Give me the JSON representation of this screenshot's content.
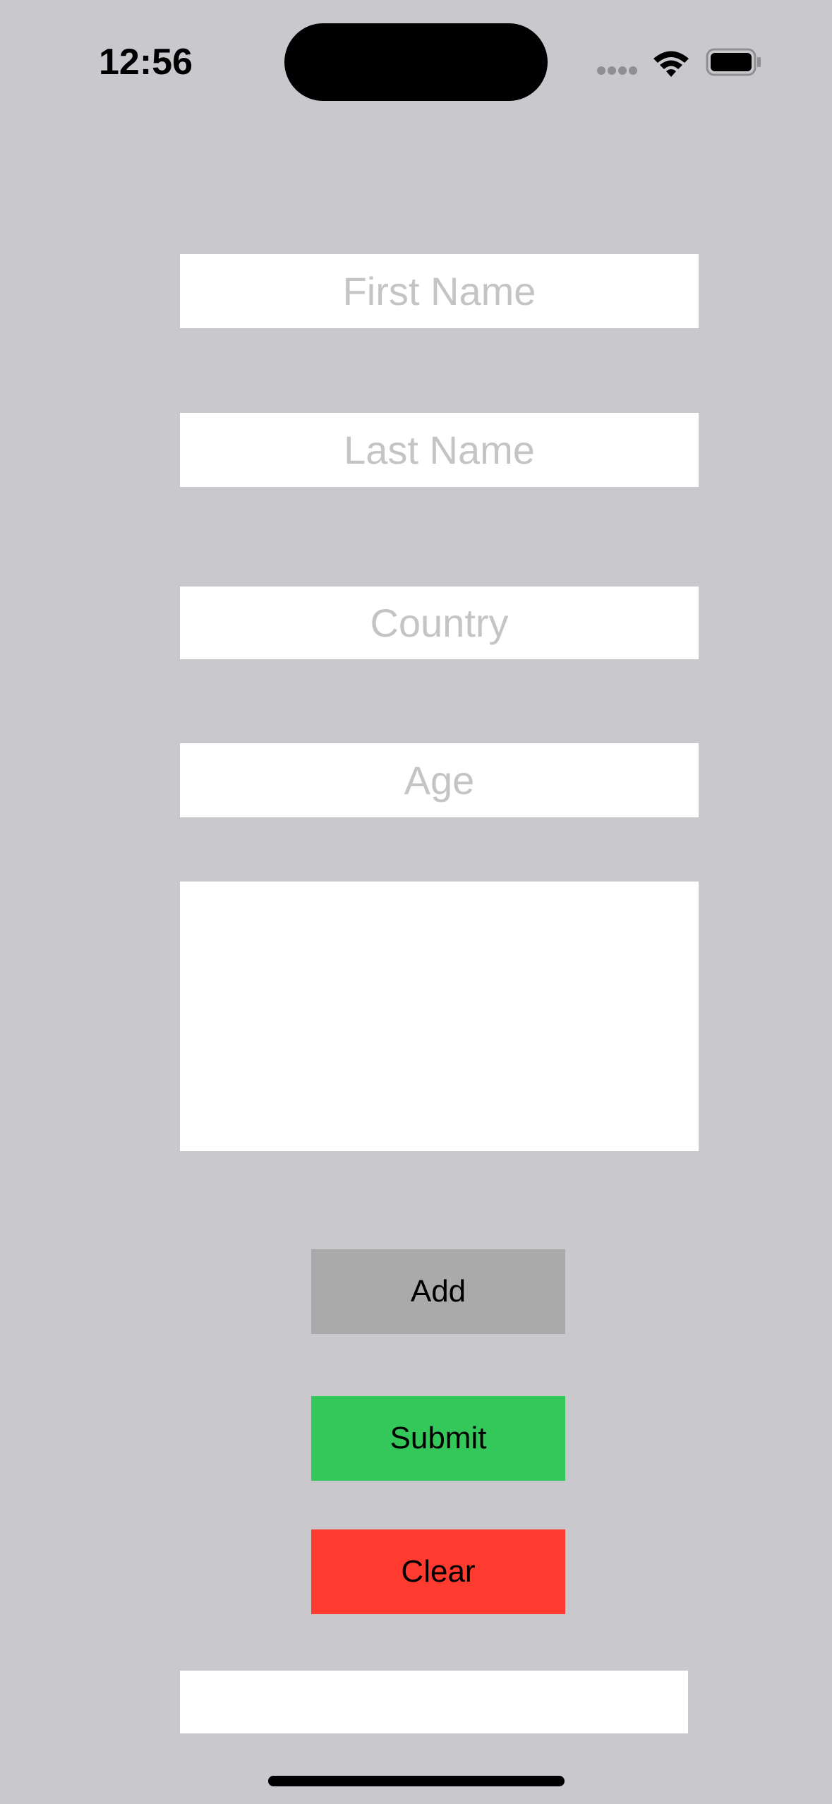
{
  "status_bar": {
    "time": "12:56",
    "icons": [
      "cellular-signal-icon",
      "wifi-icon",
      "battery-icon"
    ]
  },
  "form": {
    "first_name": {
      "placeholder": "First Name",
      "value": ""
    },
    "last_name": {
      "placeholder": "Last Name",
      "value": ""
    },
    "country": {
      "placeholder": "Country",
      "value": ""
    },
    "age": {
      "placeholder": "Age",
      "value": ""
    },
    "notes": {
      "value": ""
    }
  },
  "buttons": {
    "add_label": "Add",
    "submit_label": "Submit",
    "clear_label": "Clear"
  },
  "result": {
    "text": ""
  },
  "colors": {
    "background": "#c8c8cd",
    "add": "#aaaaaa",
    "submit": "#34c759",
    "clear": "#ff3b30",
    "placeholder": "#c4c4c7"
  }
}
